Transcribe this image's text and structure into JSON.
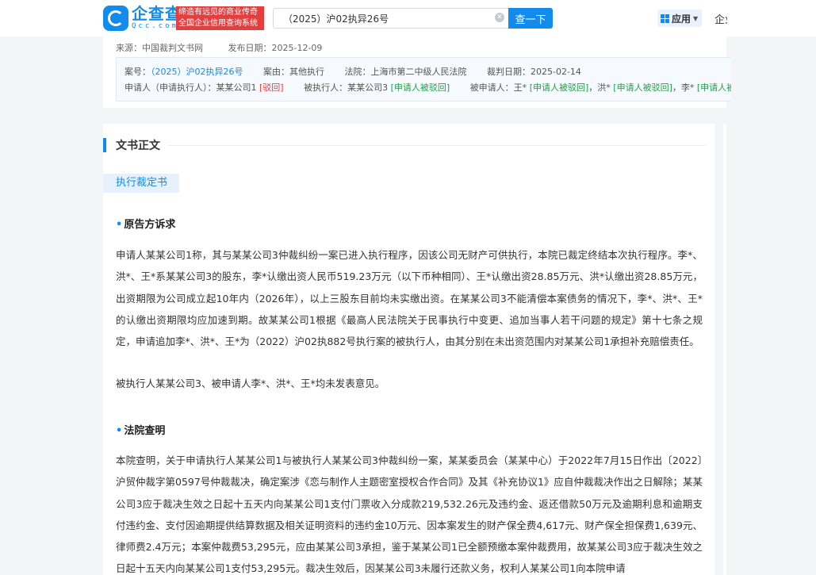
{
  "header": {
    "logo_text": "企查查",
    "logo_sub": "Qcc.com",
    "slogan_line1": "缔造有远见的商业传奇",
    "slogan_line2": "全国企业信用查询系统",
    "search_value": "（2025）沪02执异26号",
    "search_button": "查一下",
    "app_label": "应用",
    "enterprise_label": "企业"
  },
  "meta": {
    "source": "来源：中国裁判文书网",
    "publish_date": "发布日期：2025-12-09",
    "case_no_label": "案号：",
    "case_no": "（2025）沪02执异26号",
    "cause": "案由：其他执行",
    "court": "法院：上海市第二中级人民法院",
    "judge_date": "裁判日期：2025-02-14",
    "applicant_label": "申请人（申请执行人）：",
    "applicant": "某某公司1",
    "applicant_status": "[驳回]",
    "executee_label": "被执行人：",
    "executee": "某某公司3",
    "executee_status": "[申请人被驳回]",
    "respondent_label": "被申请人：",
    "respondent1": "王*",
    "respondent1_status": "[申请人被驳回]",
    "respondent2": "，洪*",
    "respondent2_status": "[申请人被驳回]",
    "respondent3": "，李*",
    "respondent3_status": "[申请人被驳回]"
  },
  "content": {
    "section_title": "文书正文",
    "tab_label": "执行裁定书",
    "sub1": "原告方诉求",
    "para1": "申请人某某公司1称，其与某某公司3仲裁纠纷一案已进入执行程序，因该公司无财产可供执行，本院已裁定终结本次执行程序。李*、洪*、王*系某某公司3的股东，李*认缴出资人民币519.23万元（以下币种相同）、王*认缴出资28.85万元、洪*认缴出资28.85万元，出资期限为公司成立起10年内（2026年），以上三股东目前均未实缴出资。在某某公司3不能清偿本案债务的情况下，李*、洪*、王*的认缴出资期限均应加速到期。故某某公司1根据《最高人民法院关于民事执行中变更、追加当事人若干问题的规定》第十七条之规定，申请追加李*、洪*、王*为（2022）沪02执882号执行案的被执行人，由其分别在未出资范围内对某某公司1承担补充赔偿责任。",
    "para2": "被执行人某某公司3、被申请人李*、洪*、王*均未发表意见。",
    "sub2": "法院查明",
    "para3": "本院查明，关于申请执行人某某公司1与被执行人某某公司3仲裁纠纷一案，某某委员会（某某中心）于2022年7月15日作出〔2022〕沪贸仲裁字第0597号仲裁裁决，确定案涉《恋与制作人主题密室授权合作合同》及其《补充协议1》应自仲裁裁决作出之日解除；某某公司3应于裁决生效之日起十五天内向某某公司1支付门票收入分成款219,532.26元及违约金、返还借款50万元及逾期利息和逾期支付违约金、支付因逾期提供结算数据及相关证明资料的违约金10万元、因本案发生的财产保全费4,617元、财产保全担保费1,639元、律师费2.4万元；本案仲裁费53,295元，应由某某公司3承担，鉴于某某公司1已全额预缴本案仲裁费用，故某某公司3应于裁决生效之日起十五天内向某某公司1支付53,295元。裁决生效后，因某某公司3未履行还款义务，权利人某某公司1向本院申请"
  }
}
